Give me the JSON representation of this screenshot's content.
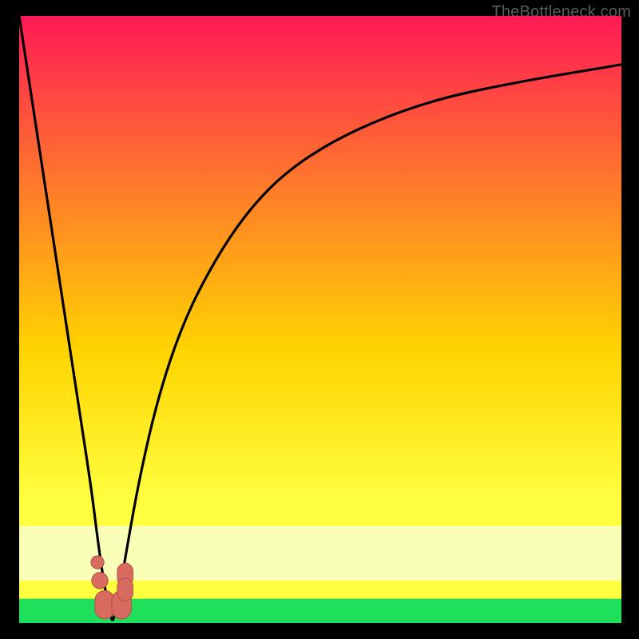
{
  "watermark": "TheBottleneck.com",
  "colors": {
    "top": "#ff1a55",
    "mid_upper": "#ff7a2b",
    "mid": "#ffd400",
    "mid_lower": "#ffff40",
    "pale_band": "#faffb8",
    "green": "#1fe05a",
    "curve": "#000000",
    "marker_fill": "#d86a60",
    "marker_stroke": "#b15048",
    "frame_bg": "#000000"
  },
  "chart_data": {
    "type": "line",
    "title": "",
    "xlabel": "",
    "ylabel": "",
    "xlim": [
      0,
      100
    ],
    "ylim": [
      0,
      100
    ],
    "series": [
      {
        "name": "bottleneck-curve",
        "x": [
          0,
          2,
          4,
          6,
          8,
          10,
          12,
          13,
          14,
          15,
          15.5,
          16,
          17,
          18,
          20,
          23,
          27,
          32,
          38,
          45,
          55,
          68,
          82,
          100
        ],
        "y": [
          100,
          87,
          74,
          61,
          48,
          35,
          22,
          14,
          7,
          2,
          0,
          2,
          7,
          13,
          24,
          37,
          49,
          59,
          68,
          75,
          81,
          86,
          89,
          92
        ]
      }
    ],
    "valley_x": 15.5,
    "markers": [
      {
        "name": "left-dot-upper",
        "x": 13.0,
        "y": 10.0,
        "r": 1.2
      },
      {
        "name": "left-dot-lower",
        "x": 13.4,
        "y": 7.0,
        "r": 1.5
      },
      {
        "name": "left-blob",
        "x": 14.2,
        "y": 3.0,
        "r": 2.0
      },
      {
        "name": "right-blob",
        "x": 17.0,
        "y": 3.0,
        "r": 2.0
      },
      {
        "name": "right-pill-top",
        "x": 17.6,
        "y": 8.0,
        "r": 1.6
      },
      {
        "name": "right-pill-bot",
        "x": 17.6,
        "y": 5.5,
        "r": 1.6
      }
    ],
    "bands": [
      {
        "name": "pale",
        "y0": 16,
        "y1": 7
      },
      {
        "name": "green",
        "y0": 4,
        "y1": 0
      }
    ]
  }
}
